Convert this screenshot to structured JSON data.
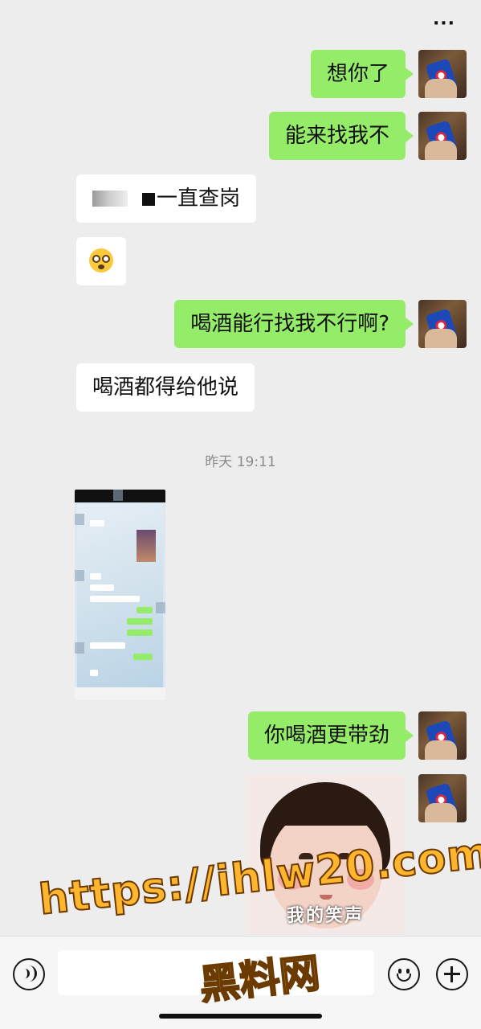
{
  "header": {
    "more_icon": "more-dots-icon",
    "more_label": "···"
  },
  "messages": [
    {
      "type": "text",
      "side": "out",
      "text": "想你了"
    },
    {
      "type": "text",
      "side": "out",
      "text": "能来找我不"
    },
    {
      "type": "text",
      "side": "in",
      "text": "一直查岗"
    },
    {
      "type": "emoji",
      "side": "in",
      "emoji": "flushed-face-emoji"
    },
    {
      "type": "text",
      "side": "out",
      "text": "喝酒能行找我不行啊?"
    },
    {
      "type": "text",
      "side": "in",
      "text": "喝酒都得给他说"
    },
    {
      "type": "time",
      "text": "昨天 19:11"
    },
    {
      "type": "image",
      "side": "in",
      "content": "chat-screenshot"
    },
    {
      "type": "text",
      "side": "out",
      "text": "你喝酒更带劲"
    },
    {
      "type": "sticker",
      "side": "out",
      "caption": "我的笑声"
    }
  ],
  "input_bar": {
    "voice_icon": "voice-icon",
    "emoji_icon": "emoji-icon",
    "plus_icon": "plus-icon",
    "input_value": ""
  },
  "watermark": {
    "url": "https://ihlw20.com",
    "name": "黑料网"
  },
  "colors": {
    "background": "#ededed",
    "bubble_out": "#95ec69",
    "bubble_in": "#ffffff",
    "watermark": "#ffb52e"
  }
}
